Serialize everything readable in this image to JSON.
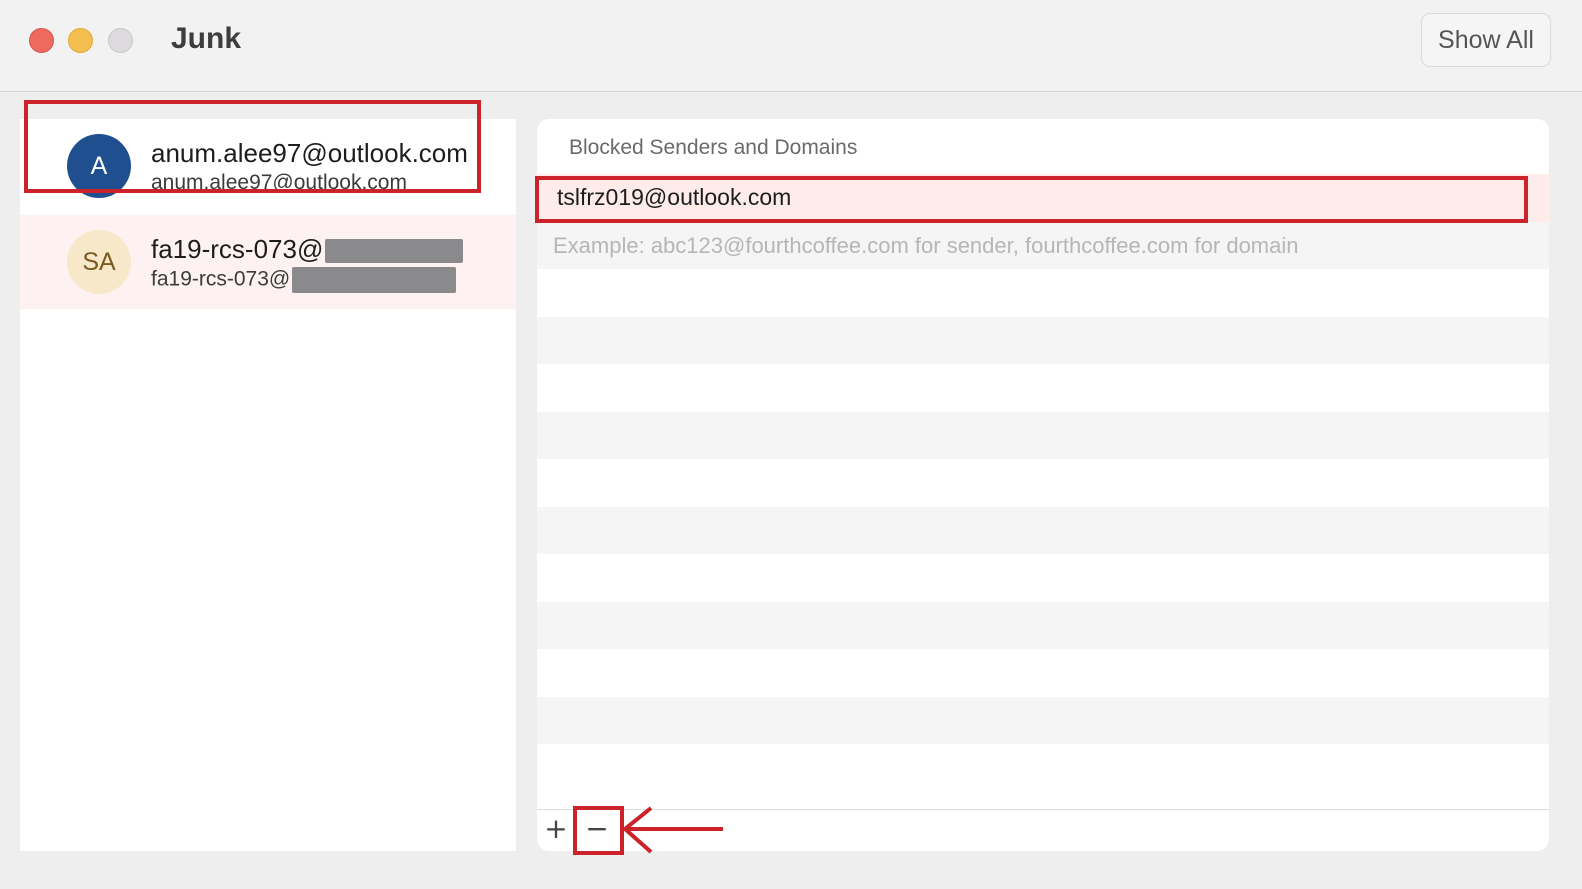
{
  "window": {
    "title": "Junk",
    "show_all_label": "Show All"
  },
  "accounts": [
    {
      "initials": "A",
      "name": "anum.alee97@outlook.com",
      "email": "anum.alee97@outlook.com",
      "avatar_color": "#1f4f8f"
    },
    {
      "initials": "SA",
      "name": "fa19-rcs-073@",
      "email": "fa19-rcs-073@",
      "avatar_color": "#f6e8c9",
      "domain_redacted": true
    }
  ],
  "blocked": {
    "header": "Blocked Senders and Domains",
    "entries": [
      "tslfrz019@outlook.com"
    ],
    "input_placeholder": "Example: abc123@fourthcoffee.com for sender, fourthcoffee.com for domain"
  },
  "footer": {
    "add_label": "+",
    "remove_label": "−"
  },
  "annotation_color": "#cc2229"
}
